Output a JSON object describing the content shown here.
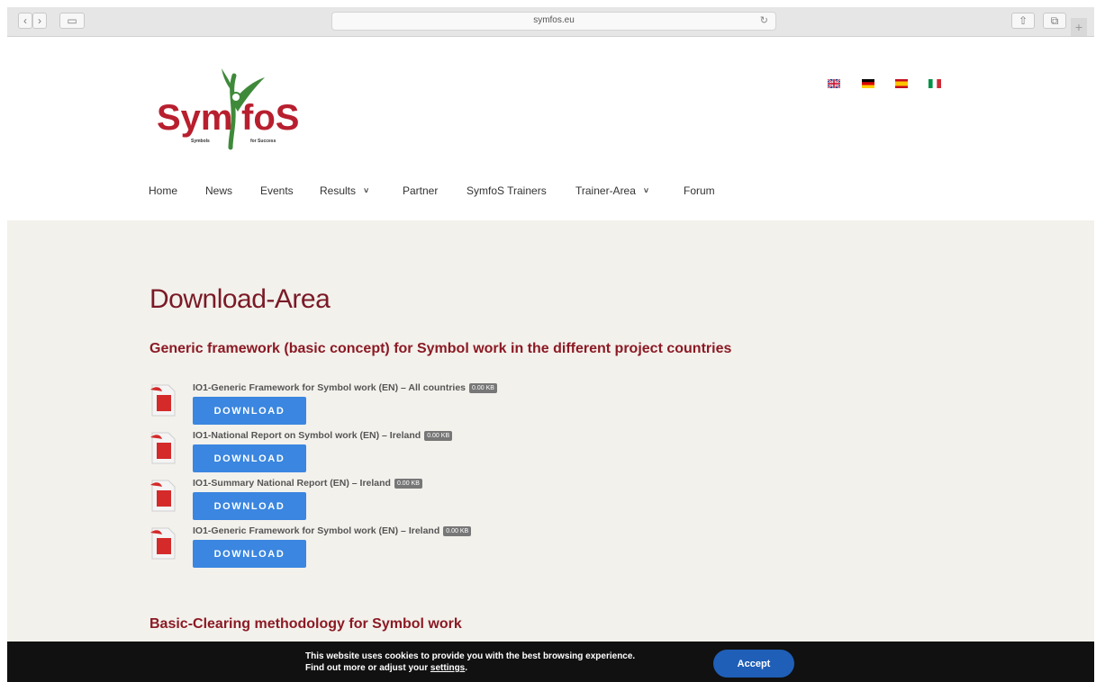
{
  "browser": {
    "url": "symfos.eu",
    "back_glyph": "‹",
    "forward_glyph": "›",
    "sidebar_glyph": "▭",
    "reload_glyph": "↻",
    "share_glyph": "⇧",
    "tabs_glyph": "⧉",
    "plus_glyph": "+"
  },
  "header": {
    "logo_text_left": "Sym",
    "logo_text_right": "foS",
    "logo_tag_left": "Symbols",
    "logo_tag_right": "for Success",
    "languages": [
      "en",
      "de",
      "es",
      "it"
    ]
  },
  "nav": {
    "items": [
      {
        "label": "Home"
      },
      {
        "label": "News"
      },
      {
        "label": "Events"
      },
      {
        "label": "Results",
        "dropdown": true
      },
      {
        "label": "Partner"
      },
      {
        "label": "SymfoS Trainers"
      },
      {
        "label": "Trainer-Area",
        "dropdown": true
      },
      {
        "label": "Forum"
      }
    ],
    "caret_glyph": "˅"
  },
  "main": {
    "page_title": "Download-Area",
    "section1_title": "Generic framework (basic concept) for Symbol work in the different project countries",
    "downloads": [
      {
        "title": "IO1-Generic Framework for Symbol work (EN) – All countries",
        "size": "0.00 KB",
        "button": "DOWNLOAD"
      },
      {
        "title": "IO1-National Report on Symbol work (EN) – Ireland",
        "size": "0.00 KB",
        "button": "DOWNLOAD"
      },
      {
        "title": "IO1-Summary National Report (EN) – Ireland",
        "size": "0.00 KB",
        "button": "DOWNLOAD"
      },
      {
        "title": "IO1-Generic Framework for Symbol work (EN) – Ireland",
        "size": "0.00 KB",
        "button": "DOWNLOAD"
      }
    ],
    "section2_title": "Basic-Clearing methodology for Symbol work"
  },
  "cookie": {
    "line1": "This website uses cookies to provide you with the best browsing experience.",
    "line2_prefix": "Find out more or adjust your ",
    "line2_link": "settings",
    "line2_suffix": ".",
    "accept": "Accept"
  },
  "colors": {
    "brand_red": "#8b1a24",
    "brand_green": "#3f8a3a",
    "button_blue": "#3a86e0",
    "accept_blue": "#1f5fb8"
  }
}
